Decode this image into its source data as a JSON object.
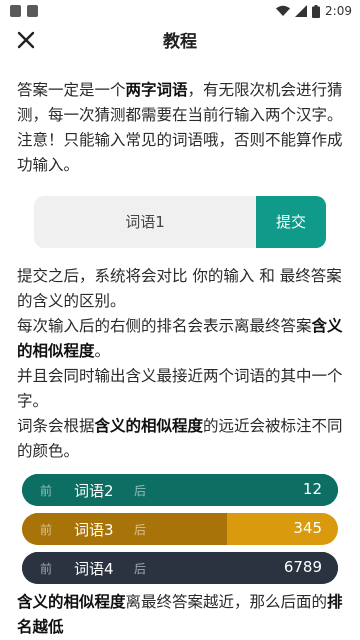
{
  "status_bar": {
    "time": "2:09"
  },
  "header": {
    "title": "教程"
  },
  "intro": {
    "p1": "答案一定是一个",
    "p1_bold": "两字词语",
    "p2": "，有无限次机会进行猜测，每一次猜测都需要在当前行输入两个汉字。注意！只能输入常见的词语哦，否则不能算作成功输入。"
  },
  "demo": {
    "input_text": "词语1",
    "submit_label": "提交"
  },
  "explain": {
    "line1": "提交之后，系统将会对比 你的输入 和 最终答案 的含义的区别。",
    "line2a": "每次输入后的右侧的排名会表示离最终答案",
    "line2_bold": "含义的相似程度",
    "line2b": "。",
    "line3": "并且会同时输出含义最接近两个词语的其中一个字。",
    "line4a": "词条会根据",
    "line4_bold": "含义的相似程度",
    "line4b": "的远近会被标注不同的颜色。"
  },
  "ranks": [
    {
      "front": "前",
      "word": "词语2",
      "back": "后",
      "rank": "12",
      "bg": "#0d6e63",
      "fill_color": "#0d6e63",
      "fill": 1.0
    },
    {
      "front": "前",
      "word": "词语3",
      "back": "后",
      "rank": "345",
      "bg": "#d99a0e",
      "fill_color": "#a8740a",
      "fill": 0.65
    },
    {
      "front": "前",
      "word": "词语4",
      "back": "后",
      "rank": "6789",
      "bg": "#2c3340",
      "fill_color": "#2c3340",
      "fill": 1.0
    }
  ],
  "footer": {
    "a_bold": "含义的相似程度",
    "a": "离最终答案越近，那么后面的",
    "b_bold": "排名越低"
  },
  "colors": {
    "accent": "#0f9a8a"
  }
}
